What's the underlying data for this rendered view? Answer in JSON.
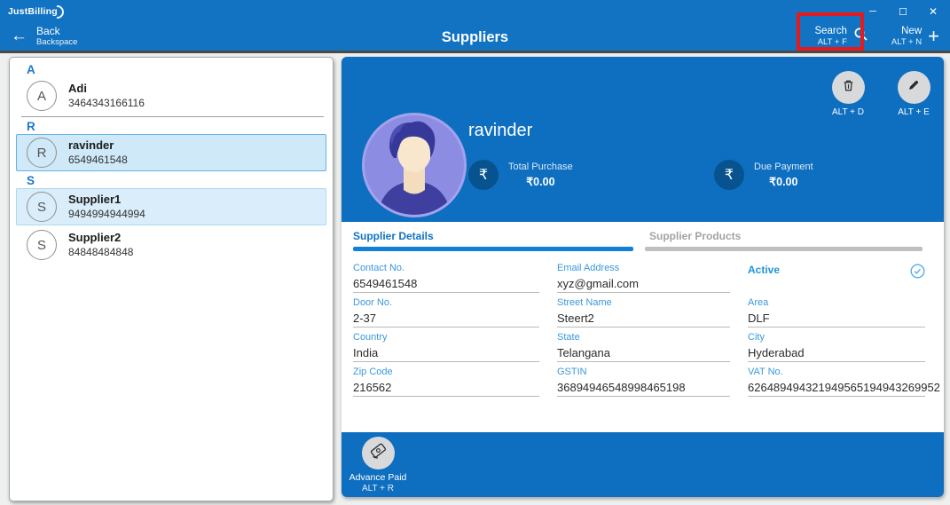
{
  "app": {
    "name": "JustBilling"
  },
  "icons": {
    "back_arrow": "←",
    "plus": "+",
    "minimize": "─",
    "maximize": "☐",
    "close": "✕",
    "rupee": "₹"
  },
  "header": {
    "back_label": "Back",
    "back_sublabel": "Backspace",
    "title": "Suppliers",
    "search_label": "Search",
    "search_shortcut": "ALT + F",
    "new_label": "New",
    "new_shortcut": "ALT + N"
  },
  "supplier_list": {
    "groups": [
      {
        "letter": "A"
      },
      {
        "letter": "R"
      },
      {
        "letter": "S"
      }
    ],
    "items": [
      {
        "initial": "A",
        "name": "Adi",
        "phone": "3464343166116"
      },
      {
        "initial": "R",
        "name": "ravinder",
        "phone": "6549461548"
      },
      {
        "initial": "S",
        "name": "Supplier1",
        "phone": "9494994944994"
      },
      {
        "initial": "S",
        "name": "Supplier2",
        "phone": "84848484848"
      }
    ]
  },
  "detail": {
    "name": "ravinder",
    "total_purchase_label": "Total Purchase",
    "total_purchase_value": "₹0.00",
    "due_payment_label": "Due Payment",
    "due_payment_value": "₹0.00",
    "delete_shortcut": "ALT + D",
    "edit_shortcut": "ALT + E",
    "tab_details": "Supplier Details",
    "tab_products": "Supplier Products",
    "status_label": "Active",
    "fields": [
      {
        "label": "Contact No.",
        "value": "6549461548"
      },
      {
        "label": "Email Address",
        "value": "xyz@gmail.com"
      },
      {
        "label": "Door No.",
        "value": "2-37"
      },
      {
        "label": "Street Name",
        "value": "Steert2"
      },
      {
        "label": "Area",
        "value": "DLF"
      },
      {
        "label": "Country",
        "value": "India"
      },
      {
        "label": "State",
        "value": "Telangana"
      },
      {
        "label": "City",
        "value": "Hyderabad"
      },
      {
        "label": "Zip Code",
        "value": "216562"
      },
      {
        "label": "GSTIN",
        "value": "36894946548998465198"
      },
      {
        "label": "VAT No.",
        "value": "626489494321949565194943269952"
      }
    ],
    "advance_paid_label": "Advance Paid",
    "advance_paid_shortcut": "ALT + R"
  },
  "colors": {
    "header_blue": "#1173c2",
    "panel_blue": "#0e6ec0",
    "dark_circle_blue": "#07538f",
    "annotation_red": "#e6191f",
    "selected_item_bg": "#cfe9f8",
    "accent_label_blue": "#3a97dd"
  }
}
